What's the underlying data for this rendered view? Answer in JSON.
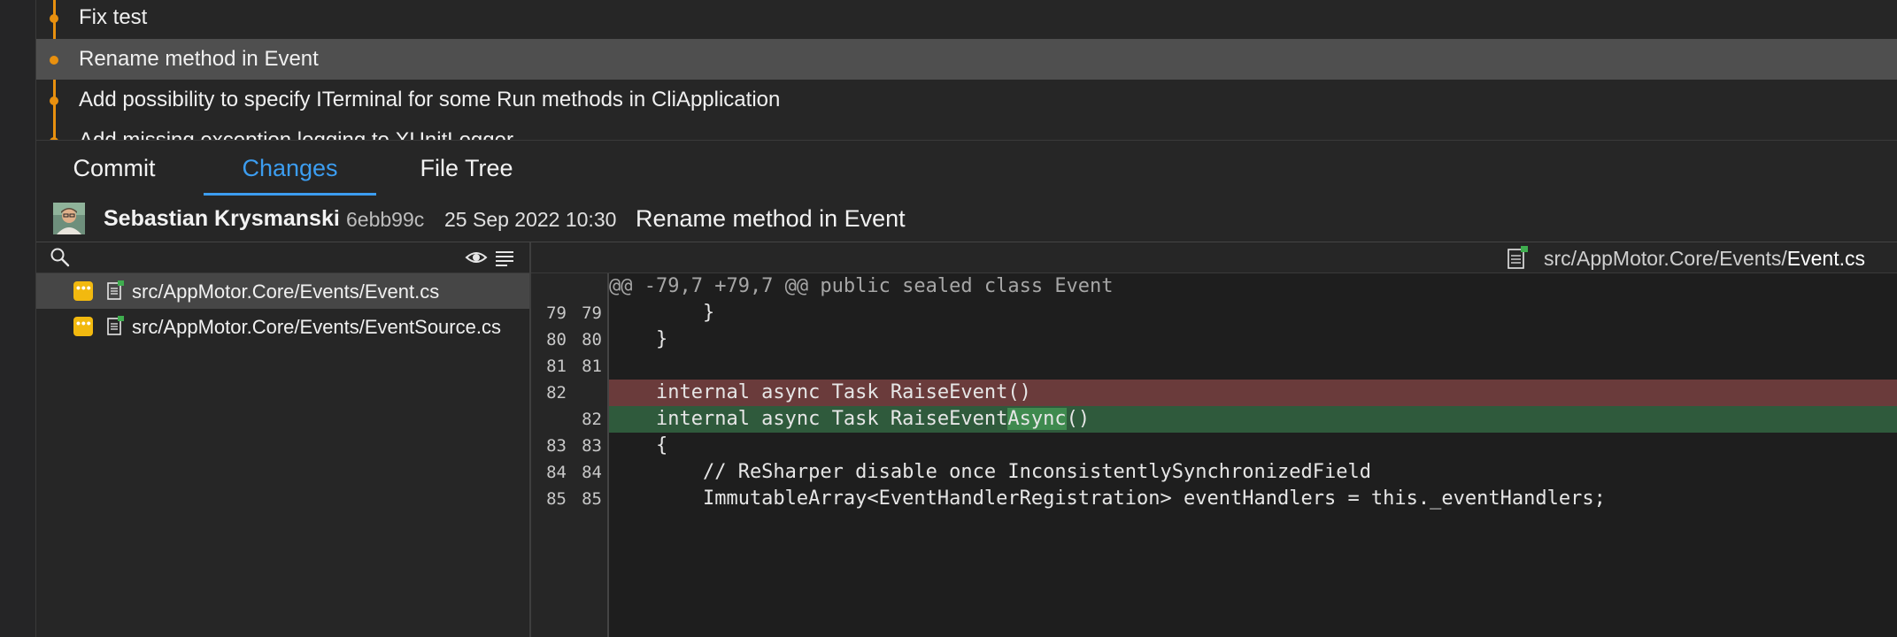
{
  "history": {
    "commits": [
      {
        "message": "Fix test"
      },
      {
        "message": "Rename method in Event"
      },
      {
        "message": "Add possibility to specify ITerminal for some Run methods in CliApplication"
      },
      {
        "message": "Add missing exception logging to XUnitLogger"
      }
    ]
  },
  "tabs": [
    {
      "label": "Commit"
    },
    {
      "label": "Changes"
    },
    {
      "label": "File Tree"
    }
  ],
  "commit": {
    "author": "Sebastian Krysmanski",
    "hash": "6ebb99c",
    "date": "25 Sep 2022 10:30",
    "title": "Rename method in Event"
  },
  "files": [
    {
      "path": "src/AppMotor.Core/Events/Event.cs",
      "status": "modified"
    },
    {
      "path": "src/AppMotor.Core/Events/EventSource.cs",
      "status": "modified"
    }
  ],
  "diff": {
    "file_dir": "src/AppMotor.Core/Events/",
    "file_name": "Event.cs",
    "lines": [
      {
        "old": "",
        "new": "",
        "text": "@@ -79,7 +79,7 @@ public sealed class Event",
        "kind": "hunk"
      },
      {
        "old": "79",
        "new": "79",
        "text": "        }",
        "kind": "context"
      },
      {
        "old": "80",
        "new": "80",
        "text": "    }",
        "kind": "context"
      },
      {
        "old": "81",
        "new": "81",
        "text": "",
        "kind": "context"
      },
      {
        "old": "82",
        "new": "",
        "text": "    internal async Task RaiseEvent()",
        "kind": "del"
      },
      {
        "old": "",
        "new": "82",
        "text_before": "    internal async Task RaiseEvent",
        "text_highlight": "Async",
        "text_after": "()",
        "kind": "add"
      },
      {
        "old": "83",
        "new": "83",
        "text": "    {",
        "kind": "context"
      },
      {
        "old": "84",
        "new": "84",
        "text": "        // ReSharper disable once InconsistentlySynchronizedField",
        "kind": "context"
      },
      {
        "old": "85",
        "new": "85",
        "text": "        ImmutableArray<EventHandlerRegistration> eventHandlers = this._eventHandlers;",
        "kind": "context"
      }
    ]
  },
  "icons": {
    "search": "search-icon",
    "eye": "eye-icon",
    "list": "list-icon",
    "modified": "modified-badge-icon",
    "file": "file-icon",
    "avatar": "avatar"
  },
  "colors": {
    "accent": "#3c9df0",
    "graph": "#e8900f",
    "modified": "#f2b90f",
    "deleted_bg": "#6a3b3b",
    "added_bg": "#2f5a3c"
  }
}
